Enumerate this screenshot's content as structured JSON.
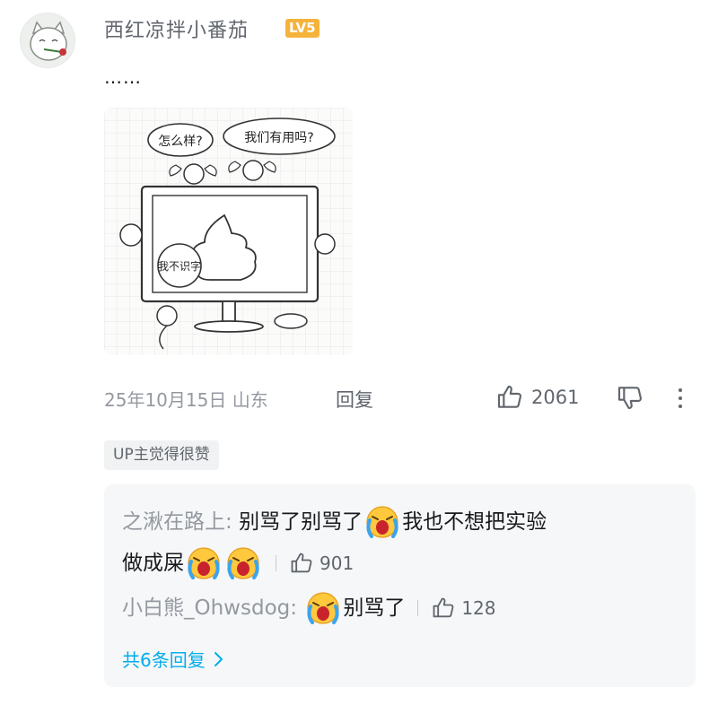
{
  "comment": {
    "username": "西红凉拌小番茄",
    "level_badge": "LV5",
    "text": "……",
    "image_text": {
      "bubble_left": "怎么样?",
      "bubble_right": "我们有用吗?",
      "screen_bubble": "我不识字"
    },
    "date": "25年10月15日 山东",
    "reply_label": "回复",
    "like_count": "2061",
    "up_tag": "UP主觉得很赞"
  },
  "replies": [
    {
      "author": "之湫在路上",
      "text_before": "别骂了别骂了",
      "text_after_line1": "我也不想把实验",
      "text_line2": "做成屎",
      "like_count": "901"
    },
    {
      "author": "小白熊_Ohwsdog",
      "text": "别骂了",
      "like_count": "128"
    }
  ],
  "more_replies_label": "共6条回复",
  "colors": {
    "accent": "#00aeec",
    "level_badge": "#f5b33b",
    "secondary_text": "#9499a0"
  }
}
